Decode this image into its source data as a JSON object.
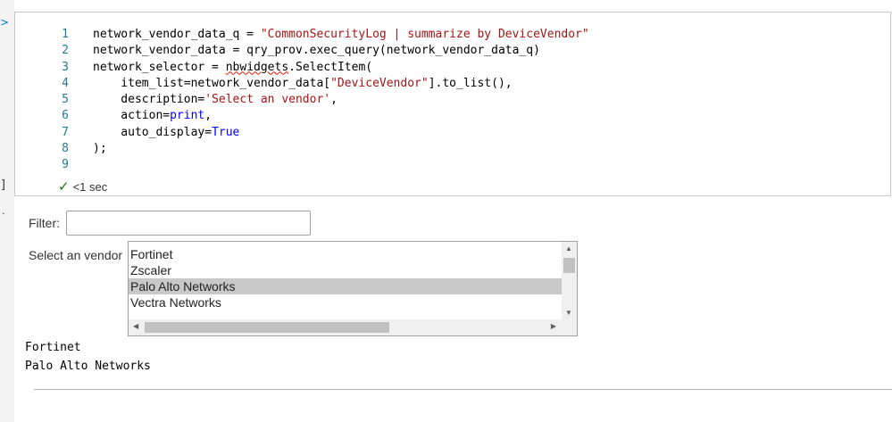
{
  "gutter": {
    "run_icon": "run-arrow-icon",
    "run_glyph": ">",
    "exec_count": "]",
    "output_marker": "."
  },
  "cell": {
    "lines": [
      {
        "n": "1",
        "tokens": [
          {
            "t": "network_vendor_data_q = ",
            "c": "src"
          },
          {
            "t": "\"CommonSecurityLog | summarize by DeviceVendor\"",
            "c": "tk-str"
          }
        ]
      },
      {
        "n": "2",
        "tokens": [
          {
            "t": "network_vendor_data = qry_prov.exec_query(network_vendor_data_q)",
            "c": "src"
          }
        ]
      },
      {
        "n": "3",
        "tokens": [
          {
            "t": "network_selector = ",
            "c": "src"
          },
          {
            "t": "nbwidgets",
            "c": "src tk-squig"
          },
          {
            "t": ".SelectItem(",
            "c": "src"
          }
        ]
      },
      {
        "n": "4",
        "tokens": [
          {
            "t": "    item_list=network_vendor_data[",
            "c": "src"
          },
          {
            "t": "\"DeviceVendor\"",
            "c": "tk-str"
          },
          {
            "t": "].to_list(),",
            "c": "src"
          }
        ]
      },
      {
        "n": "5",
        "tokens": [
          {
            "t": "    description=",
            "c": "src"
          },
          {
            "t": "'Select an vendor'",
            "c": "tk-str"
          },
          {
            "t": ",",
            "c": "src"
          }
        ]
      },
      {
        "n": "6",
        "tokens": [
          {
            "t": "    action=",
            "c": "src"
          },
          {
            "t": "print",
            "c": "tk-kw"
          },
          {
            "t": ",",
            "c": "src"
          }
        ]
      },
      {
        "n": "7",
        "tokens": [
          {
            "t": "    auto_display=",
            "c": "src"
          },
          {
            "t": "True",
            "c": "tk-kw"
          }
        ]
      },
      {
        "n": "8",
        "tokens": [
          {
            "t": ");",
            "c": "src"
          }
        ]
      },
      {
        "n": "9",
        "tokens": [
          {
            "t": "",
            "c": "src"
          }
        ]
      }
    ],
    "status": {
      "icon": "checkmark-icon",
      "glyph": "✓",
      "text": "<1 sec"
    }
  },
  "widget": {
    "filter_label": "Filter:",
    "filter_value": "",
    "select_label": "Select an vendor",
    "options": [
      "Fortinet",
      "Zscaler",
      "Palo Alto Networks",
      "Vectra Networks"
    ],
    "selected_index": 2,
    "scroll_up_glyph": "▲",
    "scroll_down_glyph": "▼",
    "scroll_left_glyph": "◀",
    "scroll_right_glyph": "▶"
  },
  "output": {
    "lines": [
      "Fortinet",
      "Palo Alto Networks"
    ]
  }
}
